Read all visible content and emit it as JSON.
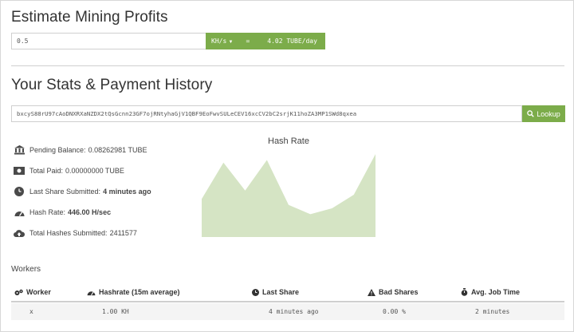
{
  "estimate": {
    "title": "Estimate Mining Profits",
    "hashrate_value": "0.5",
    "unit_label": "KH/s",
    "equals": "=",
    "result": "4.02 TUBE/day"
  },
  "stats": {
    "title": "Your Stats & Payment History",
    "address_value": "bxcyS88rU97cAoDNXRXaNZDX2tQsGcnn23GF7ojRNtyhaGjV1QBF9EoFwvSULeCEV16xcCV2bC2srjK11hoZA3MP1SWd8qxea",
    "lookup_label": "Lookup",
    "items": [
      {
        "icon": "bank-icon",
        "label": "Pending Balance:",
        "value": "0.08262981 TUBE"
      },
      {
        "icon": "money-icon",
        "label": "Total Paid:",
        "value": "0.00000000 TUBE"
      },
      {
        "icon": "clock-icon",
        "label": "Last Share Submitted:",
        "value": "4 minutes ago"
      },
      {
        "icon": "dashboard-icon",
        "label": "Hash Rate:",
        "value": "446.00 H/sec"
      },
      {
        "icon": "cloud-upload-icon",
        "label": "Total Hashes Submitted:",
        "value": "2411577"
      }
    ]
  },
  "chart_data": {
    "type": "area",
    "title": "Hash Rate",
    "values": [
      0.45,
      0.88,
      0.55,
      0.91,
      0.38,
      0.27,
      0.34,
      0.5,
      0.98
    ],
    "ylim": [
      0,
      1
    ],
    "color": "#d5e4c4"
  },
  "workers": {
    "title": "Workers",
    "headers": [
      "Worker",
      "Hashrate (15m average)",
      "Last Share",
      "Bad Shares",
      "Avg. Job Time"
    ],
    "rows": [
      [
        "x",
        "1.00 KH",
        "4 minutes ago",
        "0.00 %",
        "2 minutes"
      ]
    ]
  },
  "colors": {
    "accent": "#7cac4a",
    "chart_fill": "#d5e4c4"
  }
}
